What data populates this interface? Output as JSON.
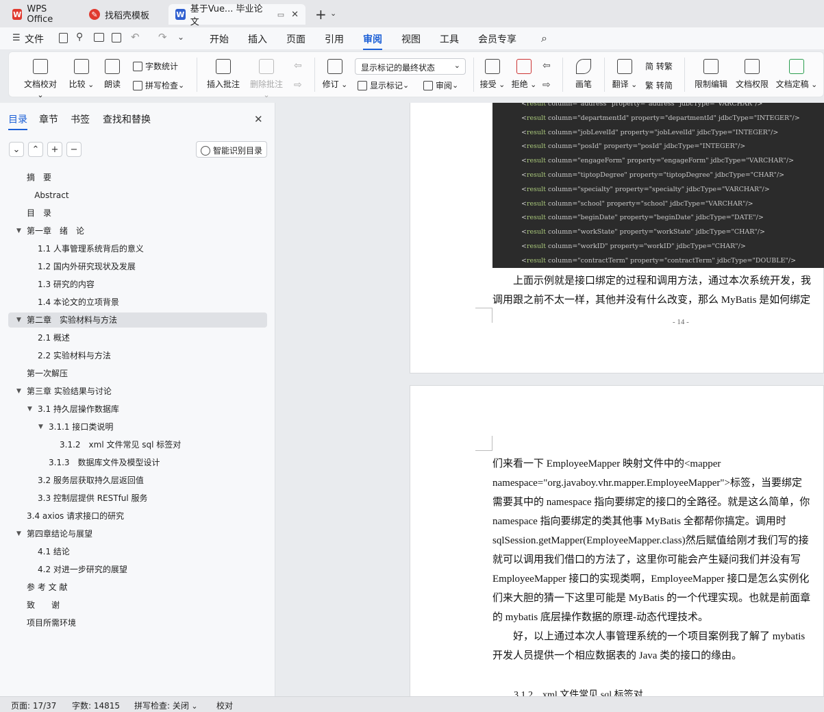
{
  "titlebar": {
    "tabs": [
      {
        "label": "WPS Office",
        "icon": "wps-logo-icon",
        "color": "#e03a2f"
      },
      {
        "label": "找稻壳模板",
        "icon": "docer-icon",
        "color": "#e03a2f"
      },
      {
        "label": "基于Vue... 毕业论文",
        "icon": "writer-icon",
        "color": "#2f5fd0"
      }
    ]
  },
  "menu": {
    "file": "文件",
    "items": [
      "开始",
      "插入",
      "页面",
      "引用",
      "审阅",
      "视图",
      "工具",
      "会员专享"
    ],
    "active": "审阅"
  },
  "ribbon": {
    "doc_check": "文档校对",
    "compare": "比较",
    "read_aloud": "朗读",
    "word_count": "字数统计",
    "spell_check": "拼写检查",
    "insert_comment": "插入批注",
    "delete_comment": "删除批注",
    "revise": "修订",
    "markup_state": "显示标记的最终状态",
    "show_markup": "显示标记",
    "review": "审阅",
    "accept": "接受",
    "reject": "拒绝",
    "pen": "画笔",
    "translate": "翻译",
    "to_trad": "简 转繁",
    "to_simp": "繁 转简",
    "restrict_edit": "限制编辑",
    "doc_perm": "文档权限",
    "finalize": "文档定稿"
  },
  "leftpanel": {
    "tabs": [
      "目录",
      "章节",
      "书签",
      "查找和替换"
    ],
    "smart_toc": "智能识别目录",
    "toc": [
      {
        "label": "摘　要",
        "level": 0
      },
      {
        "label": "Abstract",
        "level": 0.7
      },
      {
        "label": "目　录",
        "level": 0
      },
      {
        "label": "第一章　绪　论",
        "level": 0,
        "expand": true
      },
      {
        "label": "1.1  人事管理系统背后的意义",
        "level": 1
      },
      {
        "label": "1.2  国内外研究现状及发展",
        "level": 1
      },
      {
        "label": "1.3  研究的内容",
        "level": 1
      },
      {
        "label": "1.4  本论文的立项背景",
        "level": 1
      },
      {
        "label": "第二章　实验材料与方法",
        "level": 0,
        "expand": true,
        "selected": true
      },
      {
        "label": "2.1  概述",
        "level": 1
      },
      {
        "label": "2.2  实验材料与方法",
        "level": 1
      },
      {
        "label": "第一次解压",
        "level": 0
      },
      {
        "label": "第三章  实验结果与讨论",
        "level": 0,
        "expand": true
      },
      {
        "label": "3.1  持久层操作数据库",
        "level": 1,
        "expand": true
      },
      {
        "label": "3.1.1  接口类说明",
        "level": 2,
        "expand": true
      },
      {
        "label": "3.1.2　xml 文件常见 sql 标签对",
        "level": 3
      },
      {
        "label": "3.1.3　数据库文件及模型设计",
        "level": 2
      },
      {
        "label": "3.2  服务层获取持久层返回值",
        "level": 1
      },
      {
        "label": "3.3  控制层提供 RESTful 服务",
        "level": 1
      },
      {
        "label": "3.4 axios 请求接口的研究",
        "level": 0
      },
      {
        "label": "第四章结论与展望",
        "level": 0,
        "expand": true
      },
      {
        "label": "4.1  结论",
        "level": 1
      },
      {
        "label": "4.2  对进一步研究的展望",
        "level": 1
      },
      {
        "label": "参 考 文 献",
        "level": 0
      },
      {
        "label": "致　　谢",
        "level": 0
      },
      {
        "label": "项目所需环境",
        "level": 0
      }
    ]
  },
  "document": {
    "code_lines": [
      [
        "<",
        "result",
        " column=\"address\" property=\"address\" jdbcType=\"VARCHAR\"/>"
      ],
      [
        "<",
        "result",
        " column=\"departmentId\" property=\"departmentId\" jdbcType=\"INTEGER\"/>"
      ],
      [
        "<",
        "result",
        " column=\"jobLevelId\" property=\"jobLevelId\" jdbcType=\"INTEGER\"/>"
      ],
      [
        "<",
        "result",
        " column=\"posId\" property=\"posId\" jdbcType=\"INTEGER\"/>"
      ],
      [
        "<",
        "result",
        " column=\"engageForm\" property=\"engageForm\" jdbcType=\"VARCHAR\"/>"
      ],
      [
        "<",
        "result",
        " column=\"tiptopDegree\" property=\"tiptopDegree\" jdbcType=\"CHAR\"/>"
      ],
      [
        "<",
        "result",
        " column=\"specialty\" property=\"specialty\" jdbcType=\"VARCHAR\"/>"
      ],
      [
        "<",
        "result",
        " column=\"school\" property=\"school\" jdbcType=\"VARCHAR\"/>"
      ],
      [
        "<",
        "result",
        " column=\"beginDate\" property=\"beginDate\" jdbcType=\"DATE\"/>"
      ],
      [
        "<",
        "result",
        " column=\"workState\" property=\"workState\" jdbcType=\"CHAR\"/>"
      ],
      [
        "<",
        "result",
        " column=\"workID\" property=\"workID\" jdbcType=\"CHAR\"/>"
      ],
      [
        "<",
        "result",
        " column=\"contractTerm\" property=\"contractTerm\" jdbcType=\"DOUBLE\"/>"
      ]
    ],
    "page14_lines": [
      "　　上面示例就是接口绑定的过程和调用方法，通过本次系统开发，我",
      "调用跟之前不太一样，其他并没有什么改变，那么 MyBatis 是如何绑定"
    ],
    "page_number": "- 14 -",
    "page15_lines": [
      "们来看一下 EmployeeMapper 映射文件中的<mapper",
      "namespace=\"org.javaboy.vhr.mapper.EmployeeMapper\">标签，当要绑定",
      "需要其中的 namespace 指向要绑定的接口的全路径。就是这么简单，你",
      "namespace 指向要绑定的类其他事 MyBatis 全都帮你搞定。调用时",
      "sqlSession.getMapper(EmployeeMapper.class)然后赋值给刚才我们写的接",
      "就可以调用我们借口的方法了，这里你可能会产生疑问我们并没有写",
      "EmployeeMapper 接口的实现类啊，EmployeeMapper 接口是怎么实例化",
      "们来大胆的猜一下这里可能是 MyBatis 的一个代理实现。也就是前面章",
      "的 mybatis 底层操作数据的原理-动态代理技术。",
      "　　好，以上通过本次人事管理系统的一个项目案例我了解了 mybatis",
      "开发人员提供一个相应数据表的 Java 类的接口的缘由。"
    ],
    "heading_next": "3.1.2　xml 文件常见 sql 标签对"
  },
  "status": {
    "page": "页面: 17/37",
    "words": "字数: 14815",
    "spell": "拼写检查: 关闭",
    "proof": "校对"
  }
}
